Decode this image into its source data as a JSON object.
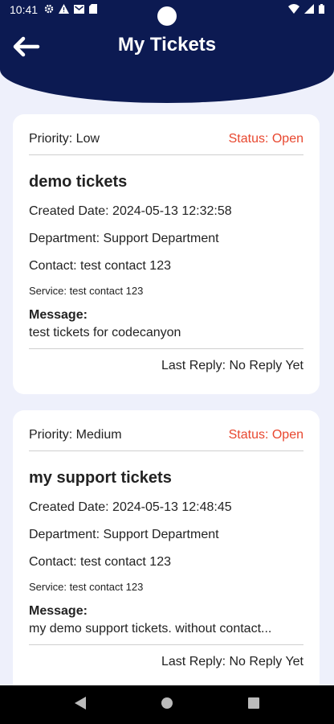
{
  "status_bar": {
    "time": "10:41"
  },
  "header": {
    "title": "My Tickets"
  },
  "tickets": [
    {
      "priority": "Priority: Low",
      "status": "Status: Open",
      "title": "demo tickets",
      "created": "Created Date: 2024-05-13 12:32:58",
      "department": "Department: Support Department",
      "contact": "Contact: test contact 123",
      "service": "Service: test contact 123",
      "message_label": "Message:",
      "message": "test tickets for codecanyon",
      "last_reply": "Last Reply: No Reply Yet"
    },
    {
      "priority": "Priority: Medium",
      "status": "Status: Open",
      "title": "my support tickets",
      "created": "Created Date: 2024-05-13 12:48:45",
      "department": "Department: Support Department",
      "contact": "Contact: test contact 123",
      "service": "Service: test contact 123",
      "message_label": "Message:",
      "message": "my demo support tickets. without contact...",
      "last_reply": "Last Reply: No Reply Yet"
    }
  ],
  "colors": {
    "primary": "#0c1a52",
    "status_open": "#e8472f",
    "background": "#eef0fb"
  }
}
